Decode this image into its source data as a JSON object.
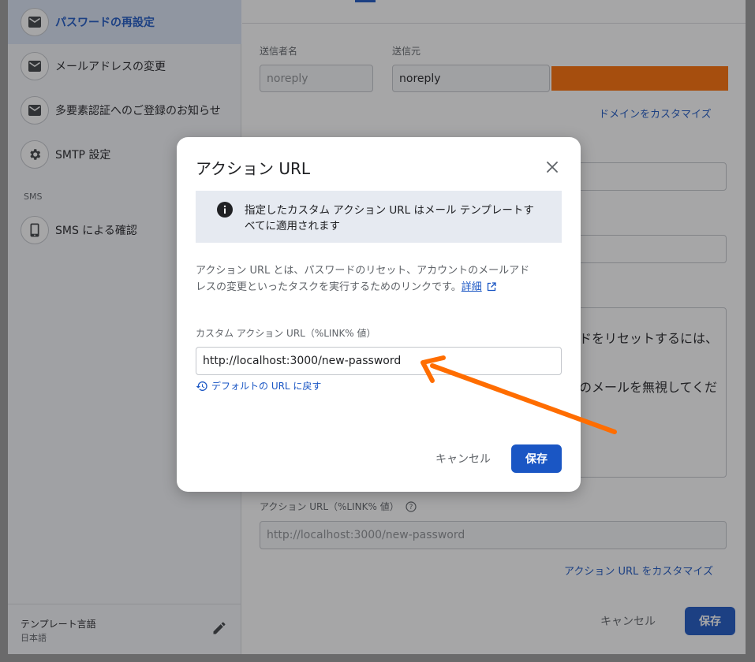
{
  "sidebar": {
    "items": [
      {
        "label": "パスワードの再設定",
        "icon": "mail-icon",
        "active": true
      },
      {
        "label": "メールアドレスの変更",
        "icon": "mail-icon"
      },
      {
        "label": "多要素認証へのご登録のお知らせ",
        "icon": "mail-icon"
      },
      {
        "label": "SMTP 設定",
        "icon": "gear-icon"
      },
      {
        "label": "SMS による確認",
        "icon": "phone-icon"
      }
    ],
    "section_sms": "SMS",
    "footer_title": "テンプレート言語",
    "footer_value": "日本語"
  },
  "form": {
    "sender_name_label": "送信者名",
    "sender_name_value": "noreply",
    "sender_from_label": "送信元",
    "sender_from_value": "noreply",
    "customize_domain_link": "ドメインをカスタマイズ",
    "body_line_1": "ドをリセットするには、",
    "body_line_2": "のメールを無視してくだ",
    "action_url_label": "アクション URL（%LINK% 値）",
    "action_url_value": "http://localhost:3000/new-password",
    "customize_action_url_link": "アクション URL をカスタマイズ",
    "cancel_label": "キャンセル",
    "save_label": "保存"
  },
  "dialog": {
    "title": "アクション URL",
    "info_line_1": "指定したカスタム アクション URL はメール テンプレートす",
    "info_line_2": "べてに適用されます",
    "desc_line_1": "アクション URL とは、パスワードのリセット、アカウントのメールアド",
    "desc_line_2": "レスの変更といったタスクを実行するためのリンクです。",
    "desc_link": "詳細",
    "input_label": "カスタム アクション URL（%LINK% 値）",
    "input_value": "http://localhost:3000/new-password",
    "reset_link": "デフォルトの URL に戻す",
    "cancel_label": "キャンセル",
    "save_label": "保存"
  },
  "colors": {
    "accent": "#1a56c4",
    "annotation_arrow": "#ff6d00",
    "redaction": "#ff6d00"
  }
}
